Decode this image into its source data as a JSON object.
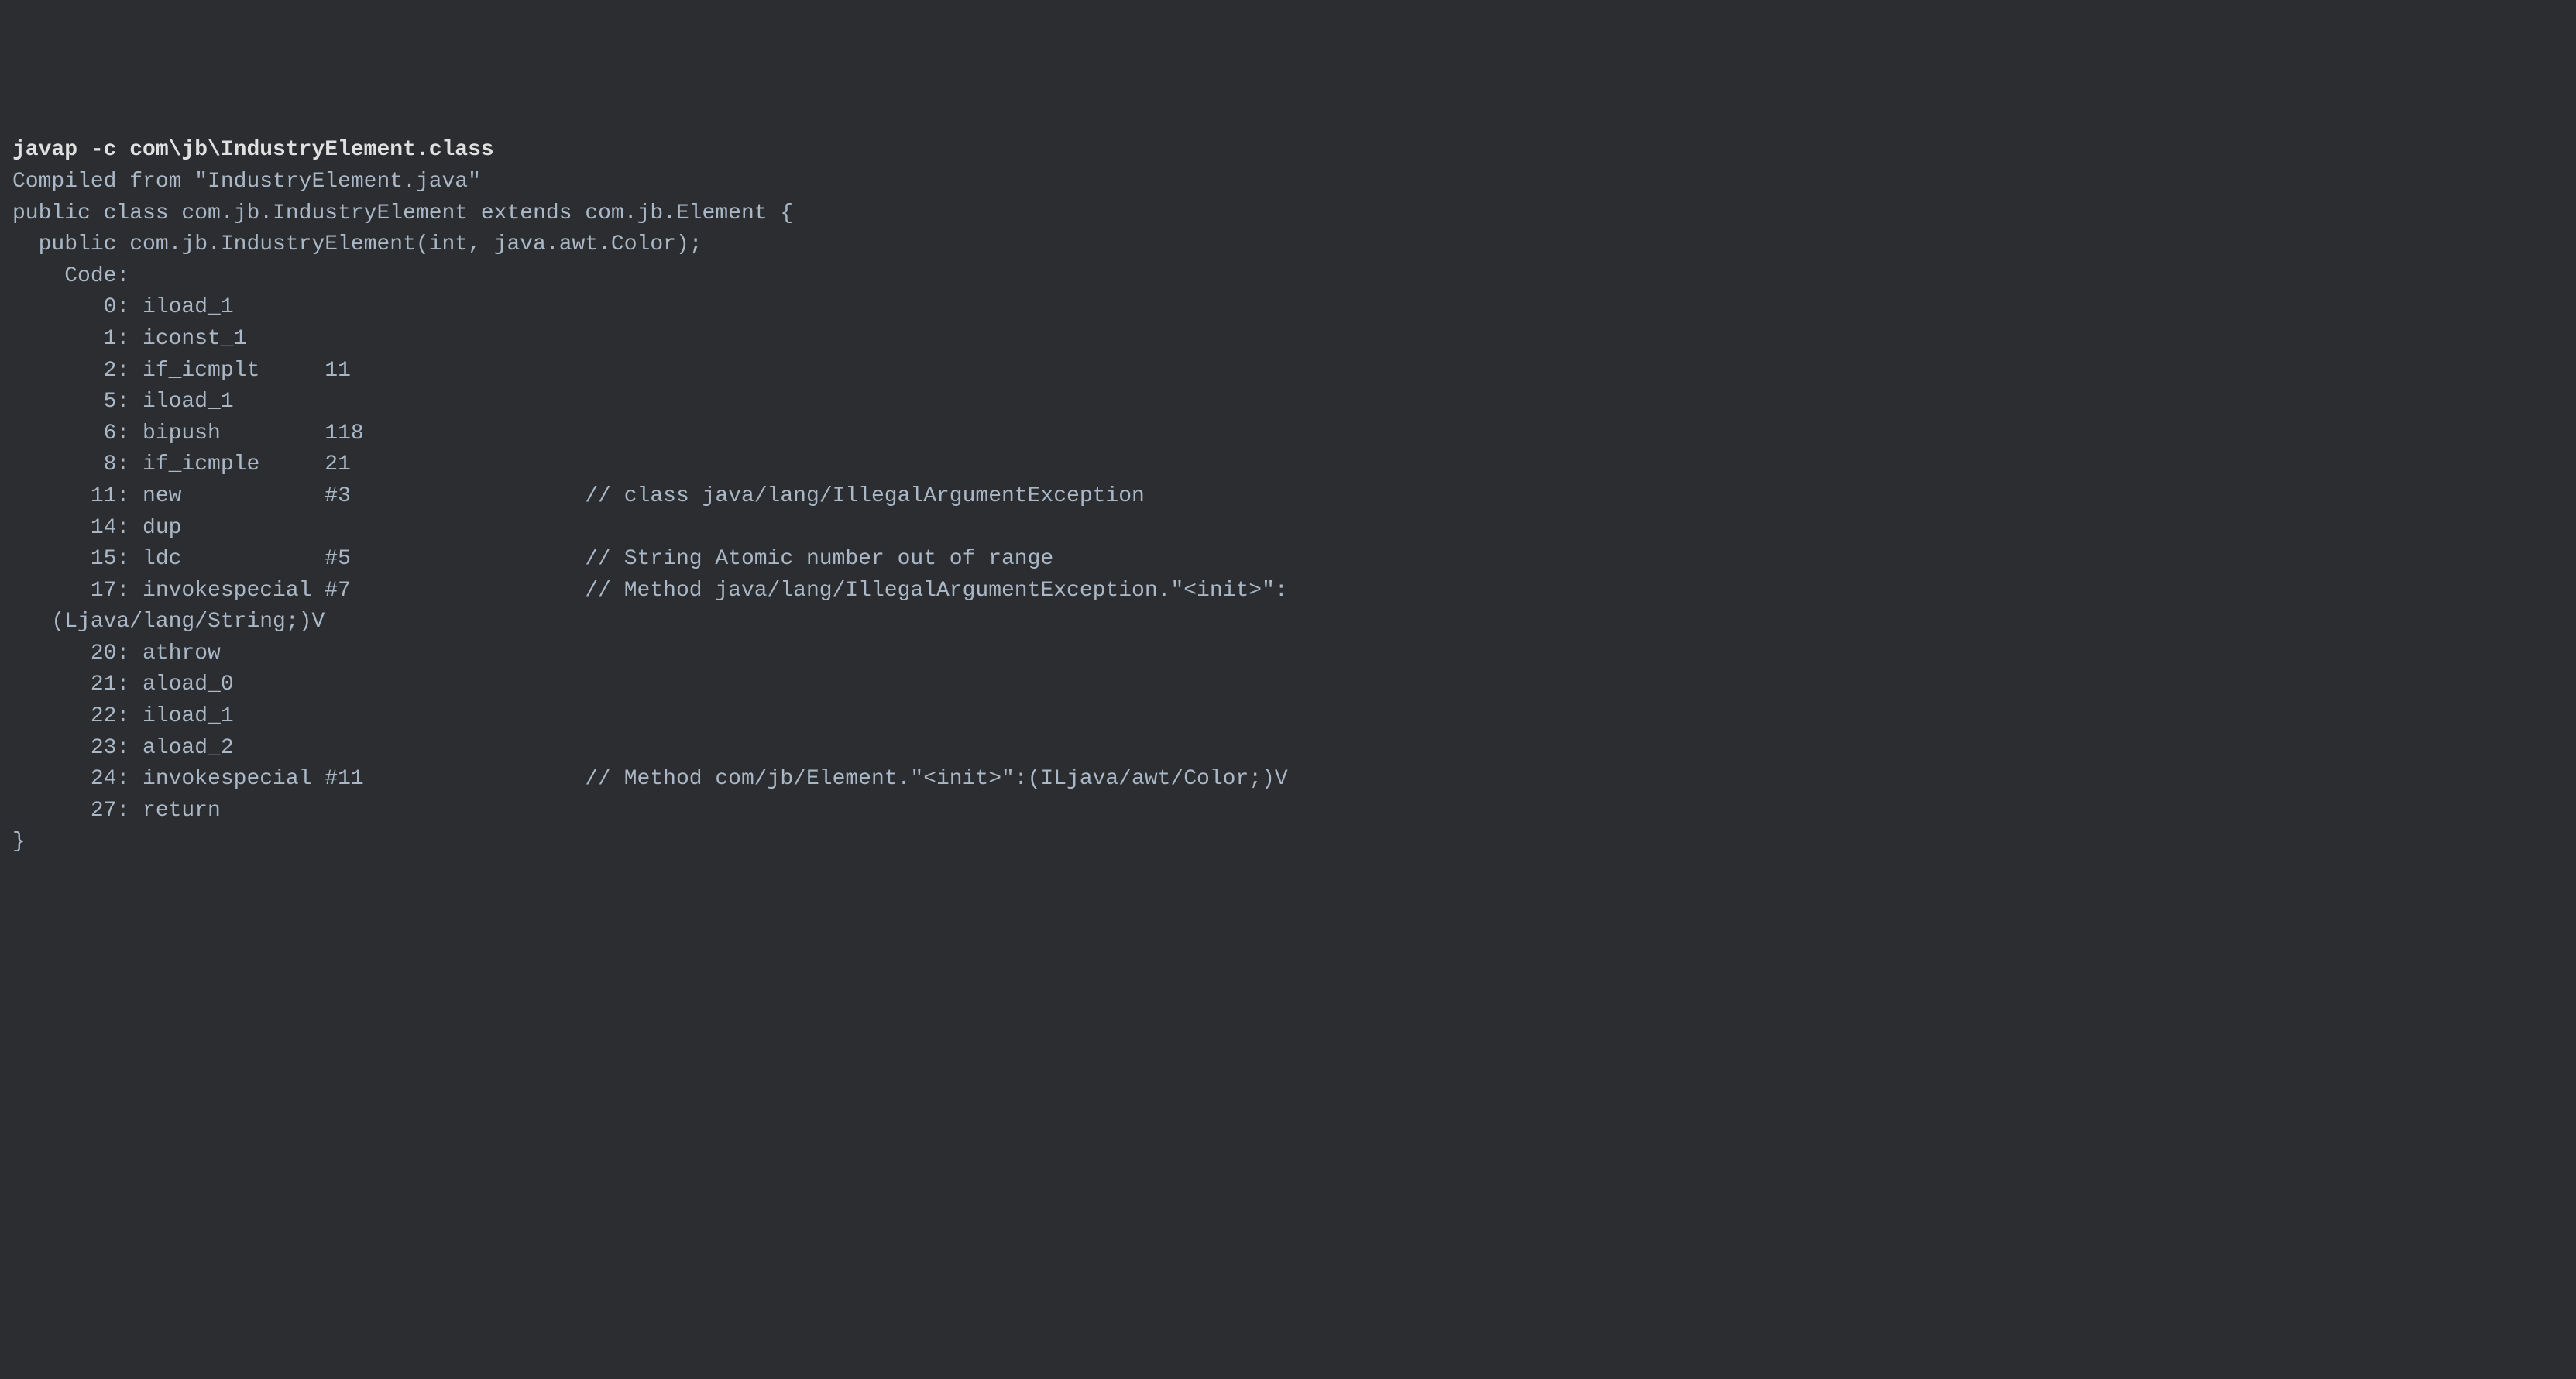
{
  "terminal": {
    "command": "javap -c com\\jb\\IndustryElement.class",
    "output_lines": [
      "Compiled from \"IndustryElement.java\"",
      "public class com.jb.IndustryElement extends com.jb.Element {",
      "  public com.jb.IndustryElement(int, java.awt.Color);",
      "    Code:",
      "       0: iload_1",
      "       1: iconst_1",
      "       2: if_icmplt     11",
      "       5: iload_1",
      "       6: bipush        118",
      "       8: if_icmple     21",
      "      11: new           #3                  // class java/lang/IllegalArgumentException",
      "      14: dup",
      "      15: ldc           #5                  // String Atomic number out of range",
      "      17: invokespecial #7                  // Method java/lang/IllegalArgumentException.\"<init>\":",
      "   (Ljava/lang/String;)V",
      "      20: athrow",
      "      21: aload_0",
      "      22: iload_1",
      "      23: aload_2",
      "      24: invokespecial #11                 // Method com/jb/Element.\"<init>\":(ILjava/awt/Color;)V",
      "      27: return",
      "}"
    ]
  }
}
